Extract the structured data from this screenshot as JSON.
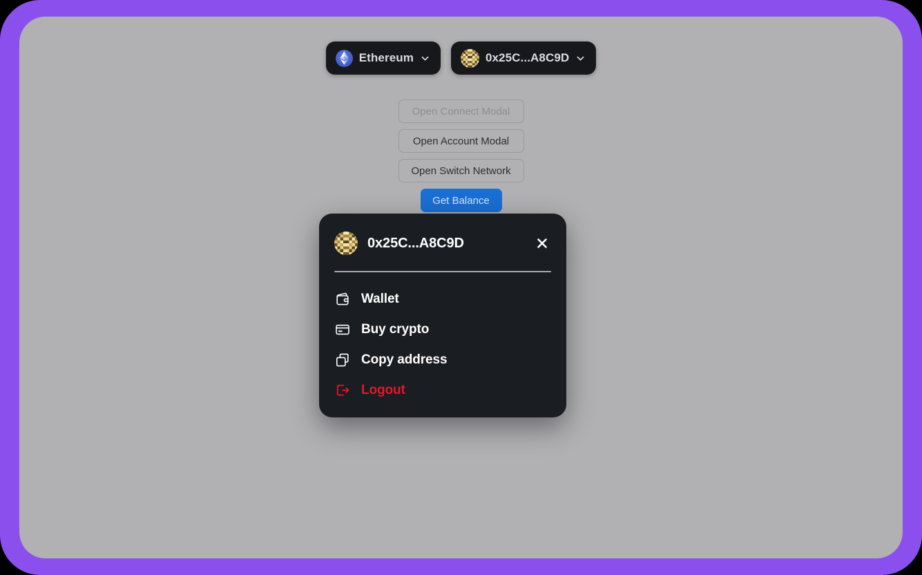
{
  "frame": {
    "border_color": "#8B4FEE",
    "page_background": "#B1B1B3"
  },
  "header": {
    "chain_pill": {
      "icon": "ethereum-logo-icon",
      "label": "Ethereum",
      "chevron": "chevron-down-icon"
    },
    "account_pill": {
      "icon": "wallet-blockie-avatar",
      "label": "0x25C...A8C9D",
      "chevron": "chevron-down-icon"
    }
  },
  "actions": {
    "buttons": [
      {
        "label": "Open Connect Modal",
        "state": "disabled",
        "variant": "outline"
      },
      {
        "label": "Open Account Modal",
        "state": "enabled",
        "variant": "outline"
      },
      {
        "label": "Open Switch Network",
        "state": "enabled",
        "variant": "outline"
      },
      {
        "label": "Get Balance",
        "state": "enabled",
        "variant": "primary",
        "color": "#1A6FD4"
      }
    ]
  },
  "account_modal": {
    "avatar": "wallet-blockie-avatar",
    "address": "0x25C...A8C9D",
    "close_icon": "close-icon",
    "menu": [
      {
        "label": "Wallet",
        "icon": "wallet-icon",
        "color": "#FFFFFF"
      },
      {
        "label": "Buy crypto",
        "icon": "credit-card-icon",
        "color": "#FFFFFF"
      },
      {
        "label": "Copy address",
        "icon": "copy-icon",
        "color": "#FFFFFF"
      },
      {
        "label": "Logout",
        "icon": "logout-icon",
        "color": "#E8152B"
      }
    ]
  }
}
